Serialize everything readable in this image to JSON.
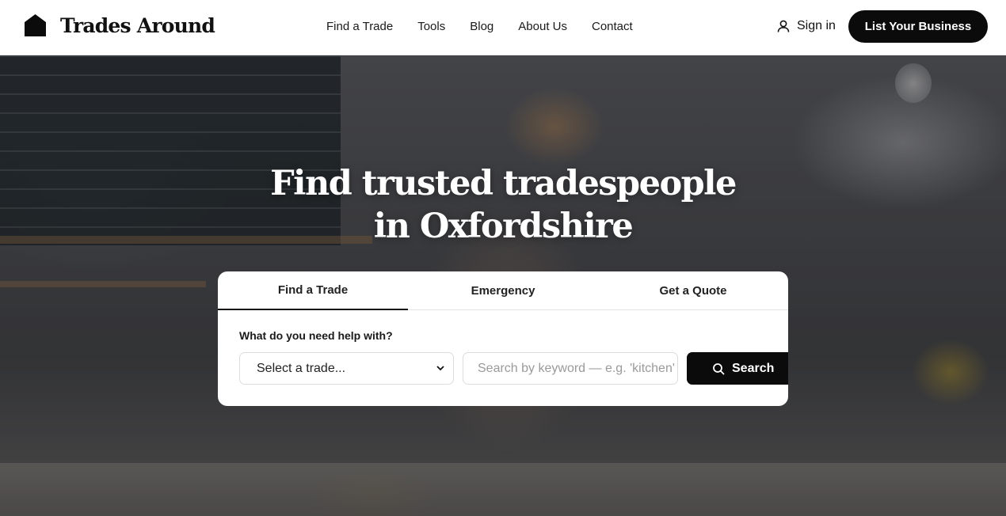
{
  "header": {
    "logo_text": "Trades Around",
    "nav": [
      "Find a Trade",
      "Tools",
      "Blog",
      "About Us",
      "Contact"
    ],
    "sign_in": "Sign in",
    "list_business": "List Your Business"
  },
  "hero": {
    "title_line1": "Find trusted tradespeople",
    "title_line2": "in Oxfordshire"
  },
  "search": {
    "tabs": [
      "Find a Trade",
      "Emergency",
      "Get a Quote"
    ],
    "active_tab": "Find a Trade",
    "help_label": "What do you need help with?",
    "trade_select_value": "Select a trade...",
    "keyword_placeholder": "Search by keyword — e.g. 'kitchen'",
    "search_button": "Search"
  },
  "icons": {
    "logo": "house-icon",
    "sign_in": "user-icon",
    "select": "chevron-down-icon",
    "search": "search-icon"
  }
}
